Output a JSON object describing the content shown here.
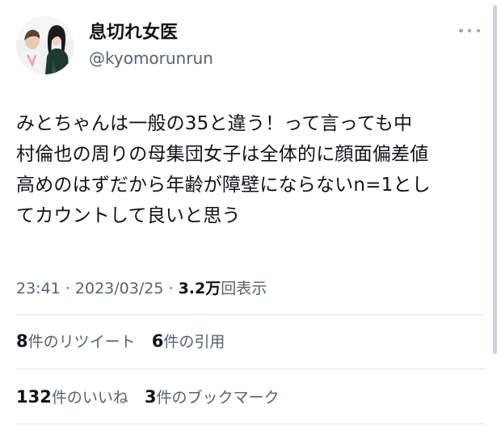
{
  "author": {
    "display_name": "息切れ女医",
    "handle": "@kyomorunrun",
    "avatar_icon": "profile-photo"
  },
  "tweet": {
    "lines": [
      "みとちゃんは一般の35と違う！って言っても中",
      "村倫也の周りの母集団女子は全体的に顔面偏差値",
      "高めのはずだから年齢が障壁にならないn=1とし",
      "てカウントして良いと思う"
    ]
  },
  "meta": {
    "time": "23:41",
    "sep1": "·",
    "date": "2023/03/25",
    "sep2": "·",
    "views_count": "3.2万",
    "views_label": "回表示"
  },
  "stats_row1": {
    "retweets_count": "8",
    "retweets_label": "件のリツイート",
    "quotes_count": "6",
    "quotes_label": "件の引用"
  },
  "stats_row2": {
    "likes_count": "132",
    "likes_label": "件のいいね",
    "bookmarks_count": "3",
    "bookmarks_label": "件のブックマーク"
  },
  "colors": {
    "text_primary": "#0f1419",
    "text_secondary": "#536471",
    "divider": "#e1e5e8"
  }
}
